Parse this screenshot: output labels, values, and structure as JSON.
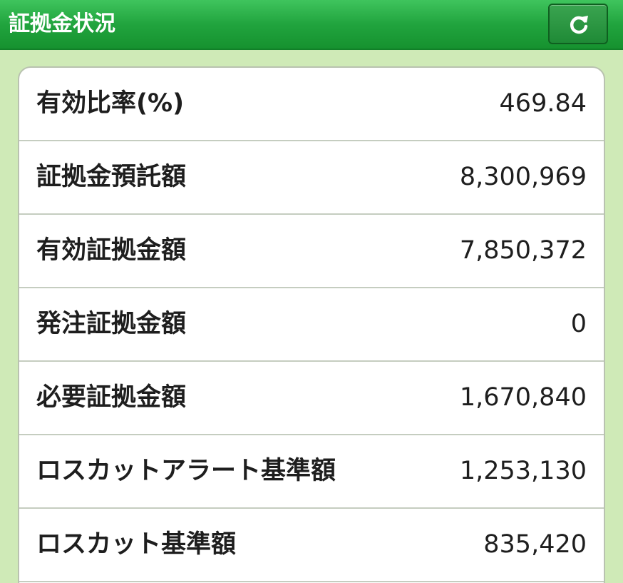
{
  "header": {
    "title": "証拠金状況",
    "refresh_icon": "refresh-icon"
  },
  "colors": {
    "header_green": "#21a43e",
    "background": "#cfeab7",
    "panel": "#ffffff"
  },
  "rows": [
    {
      "label": "有効比率(%)",
      "value": "469.84"
    },
    {
      "label": "証拠金預託額",
      "value": "8,300,969"
    },
    {
      "label": "有効証拠金額",
      "value": "7,850,372"
    },
    {
      "label": "発注証拠金額",
      "value": "0"
    },
    {
      "label": "必要証拠金額",
      "value": "1,670,840"
    },
    {
      "label": "ロスカットアラート基準額",
      "value": "1,253,130"
    },
    {
      "label": "ロスカット基準額",
      "value": "835,420"
    }
  ]
}
